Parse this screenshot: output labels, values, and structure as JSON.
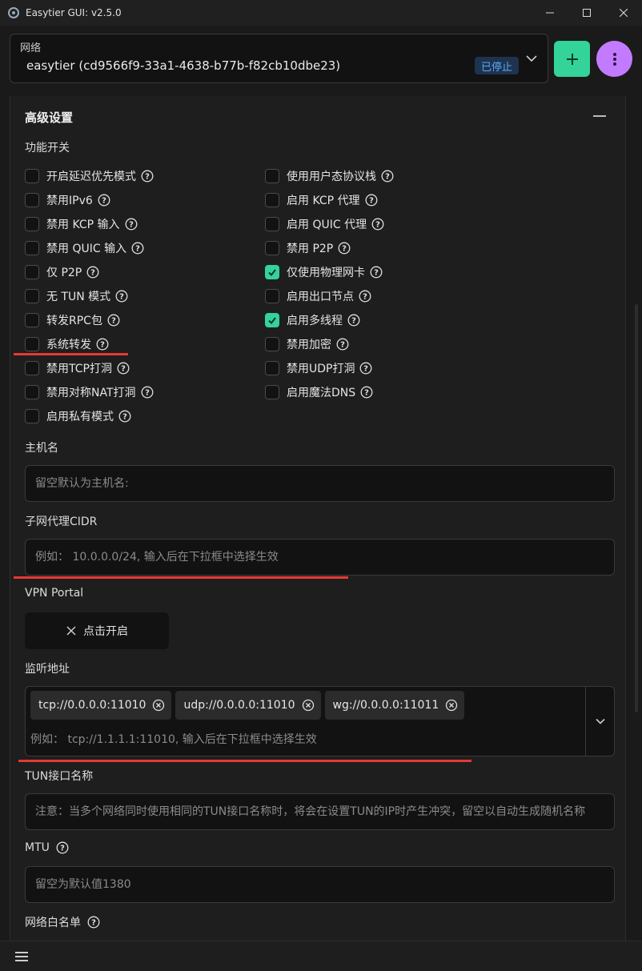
{
  "window": {
    "title": "Easytier GUI: v2.5.0",
    "controls": {
      "minimize": "—",
      "maximize": "☐",
      "close": "✕"
    }
  },
  "network": {
    "label": "网络",
    "value": "easytier (cd9566f9-33a1-4638-b77b-f82cb10dbe23)",
    "status": "已停止",
    "add_icon": "plus-icon",
    "more_icon": "more-vertical-icon"
  },
  "advanced": {
    "title": "高级设置",
    "features_label": "功能开关",
    "left_toggles": [
      {
        "label": "开启延迟优先模式",
        "checked": false
      },
      {
        "label": "禁用IPv6",
        "checked": false
      },
      {
        "label": "禁用 KCP 输入",
        "checked": false
      },
      {
        "label": "禁用 QUIC 输入",
        "checked": false
      },
      {
        "label": "仅 P2P",
        "checked": false
      },
      {
        "label": "无 TUN 模式",
        "checked": false
      },
      {
        "label": "转发RPC包",
        "checked": false
      },
      {
        "label": "系统转发",
        "checked": false
      },
      {
        "label": "禁用TCP打洞",
        "checked": false
      },
      {
        "label": "禁用对称NAT打洞",
        "checked": false
      },
      {
        "label": "启用私有模式",
        "checked": false
      }
    ],
    "right_toggles": [
      {
        "label": "使用用户态协议栈",
        "checked": false
      },
      {
        "label": "启用 KCP 代理",
        "checked": false
      },
      {
        "label": "启用 QUIC 代理",
        "checked": false
      },
      {
        "label": "禁用 P2P",
        "checked": false
      },
      {
        "label": "仅使用物理网卡",
        "checked": true
      },
      {
        "label": "启用出口节点",
        "checked": false
      },
      {
        "label": "启用多线程",
        "checked": true
      },
      {
        "label": "禁用加密",
        "checked": false
      },
      {
        "label": "禁用UDP打洞",
        "checked": false
      },
      {
        "label": "启用魔法DNS",
        "checked": false
      }
    ],
    "hostname": {
      "label": "主机名",
      "placeholder": "留空默认为主机名:"
    },
    "subnet_proxy": {
      "label": "子网代理CIDR",
      "placeholder": "例如： 10.0.0.0/24, 输入后在下拉框中选择生效"
    },
    "vpn_portal": {
      "label": "VPN Portal",
      "button": "点击开启"
    },
    "listeners": {
      "label": "监听地址",
      "values": [
        "tcp://0.0.0.0:11010",
        "udp://0.0.0.0:11010",
        "wg://0.0.0.0:11011"
      ],
      "placeholder": "例如： tcp://1.1.1.1:11010, 输入后在下拉框中选择生效"
    },
    "tun_name": {
      "label": "TUN接口名称",
      "placeholder": "注意：当多个网络同时使用相同的TUN接口名称时，将会在设置TUN的IP时产生冲突，留空以自动生成随机名称"
    },
    "mtu": {
      "label": "MTU",
      "placeholder": "留空为默认值1380"
    },
    "whitelist": {
      "label": "网络白名单"
    }
  },
  "colors": {
    "accent_green": "#34d399",
    "accent_purple": "#c27aff",
    "status_blue": "#5aaaf5",
    "annotation_red": "#e53935"
  }
}
